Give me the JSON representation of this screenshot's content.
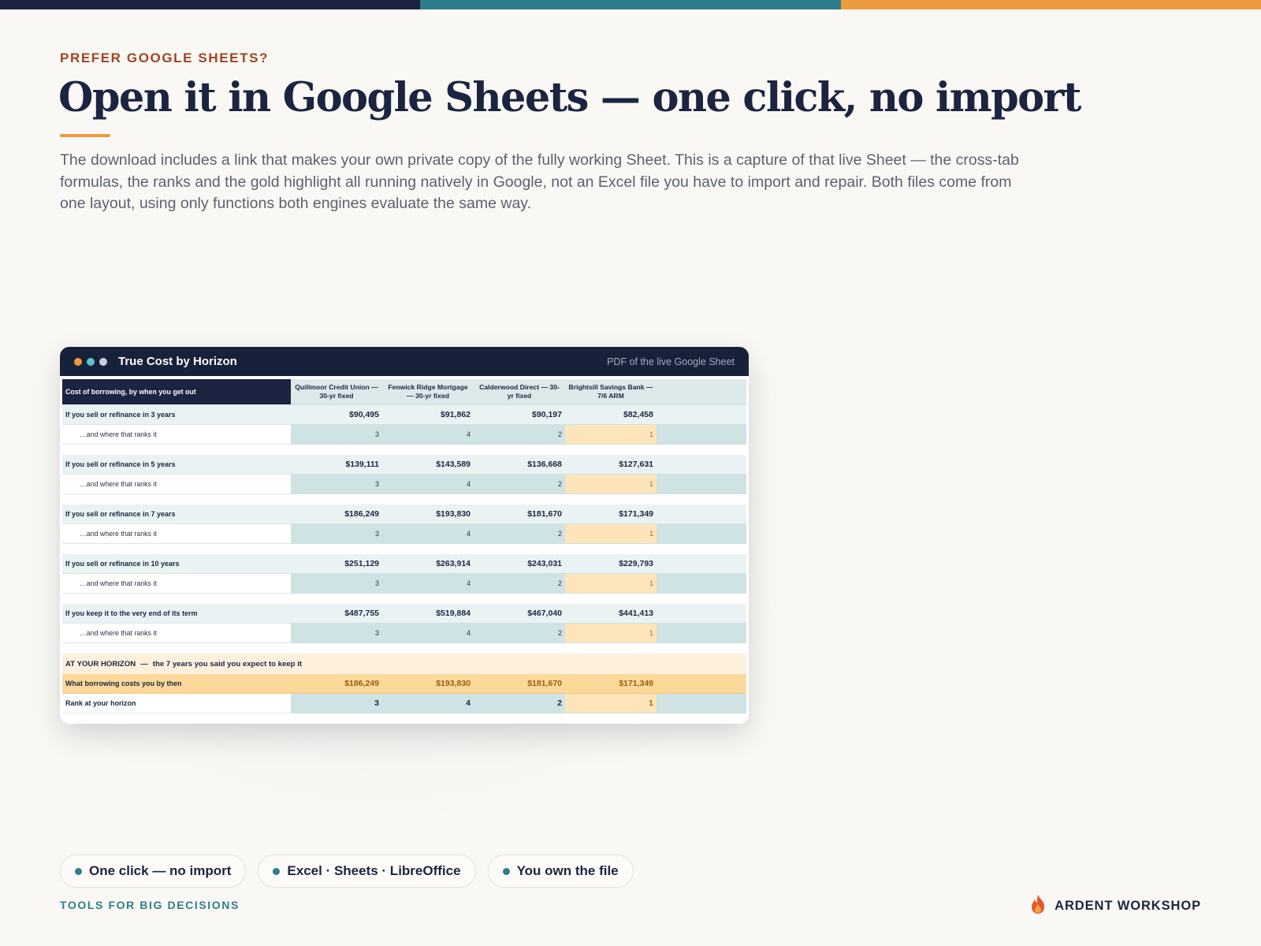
{
  "colors": {
    "navy": "#1b2541",
    "teal": "#2e7d8c",
    "orange": "#ec9a3e",
    "rust": "#a04421",
    "gold_highlight": "#fde5b9",
    "horizon_band": "#fcd89a"
  },
  "eyebrow": "PREFER GOOGLE SHEETS?",
  "headline": "Open it in Google Sheets — one click, no import",
  "intro": "The download includes a link that makes your own private copy of the fully working Sheet. This is a capture of that live Sheet — the cross-tab formulas, the ranks and the gold highlight all running natively in Google, not an Excel file you have to import and repair. Both files come from one layout, using only functions both engines evaluate the same way.",
  "window": {
    "title": "True Cost by Horizon",
    "note": "PDF of the live Google Sheet",
    "dots": [
      "#ec9a3e",
      "#5bc4d0",
      "#c9cfdb"
    ]
  },
  "sheet": {
    "corner_label": "Cost of borrowing, by when you get out",
    "lenders": [
      "Quillmoor Credit Union — 30-yr fixed",
      "Fenwick Ridge Mortgage — 30-yr fixed",
      "Calderwood Direct — 30-yr fixed",
      "Brightsill Savings Bank — 7/6 ARM"
    ],
    "rank_label": "…and where that ranks it",
    "horizons": [
      {
        "label": "If you sell or refinance in 3 years",
        "costs": [
          "$90,495",
          "$91,862",
          "$90,197",
          "$82,458"
        ],
        "ranks": [
          "3",
          "4",
          "2",
          "1"
        ]
      },
      {
        "label": "If you sell or refinance in 5 years",
        "costs": [
          "$139,111",
          "$143,589",
          "$136,668",
          "$127,631"
        ],
        "ranks": [
          "3",
          "4",
          "2",
          "1"
        ]
      },
      {
        "label": "If you sell or refinance in 7 years",
        "costs": [
          "$186,249",
          "$193,830",
          "$181,670",
          "$171,349"
        ],
        "ranks": [
          "3",
          "4",
          "2",
          "1"
        ]
      },
      {
        "label": "If you sell or refinance in 10 years",
        "costs": [
          "$251,129",
          "$263,914",
          "$243,031",
          "$229,793"
        ],
        "ranks": [
          "3",
          "4",
          "2",
          "1"
        ]
      },
      {
        "label": "If you keep it to the very end of its term",
        "costs": [
          "$487,755",
          "$519,884",
          "$467,040",
          "$441,413"
        ],
        "ranks": [
          "3",
          "4",
          "2",
          "1"
        ]
      }
    ],
    "at_horizon": {
      "heading": "AT YOUR HORIZON",
      "dash": "—",
      "text": "the 7 years you said you expect to keep it",
      "cost_label": "What borrowing costs you by then",
      "costs": [
        "$186,249",
        "$193,830",
        "$181,670",
        "$171,349"
      ],
      "rank_label": "Rank at your horizon",
      "ranks": [
        "3",
        "4",
        "2",
        "1"
      ]
    }
  },
  "pills": [
    "One click — no import",
    "Excel · Sheets · LibreOffice",
    "You own the file"
  ],
  "tagline": "TOOLS FOR BIG DECISIONS",
  "brand": {
    "name": "ARDENT WORKSHOP",
    "icon": "flame-icon"
  }
}
